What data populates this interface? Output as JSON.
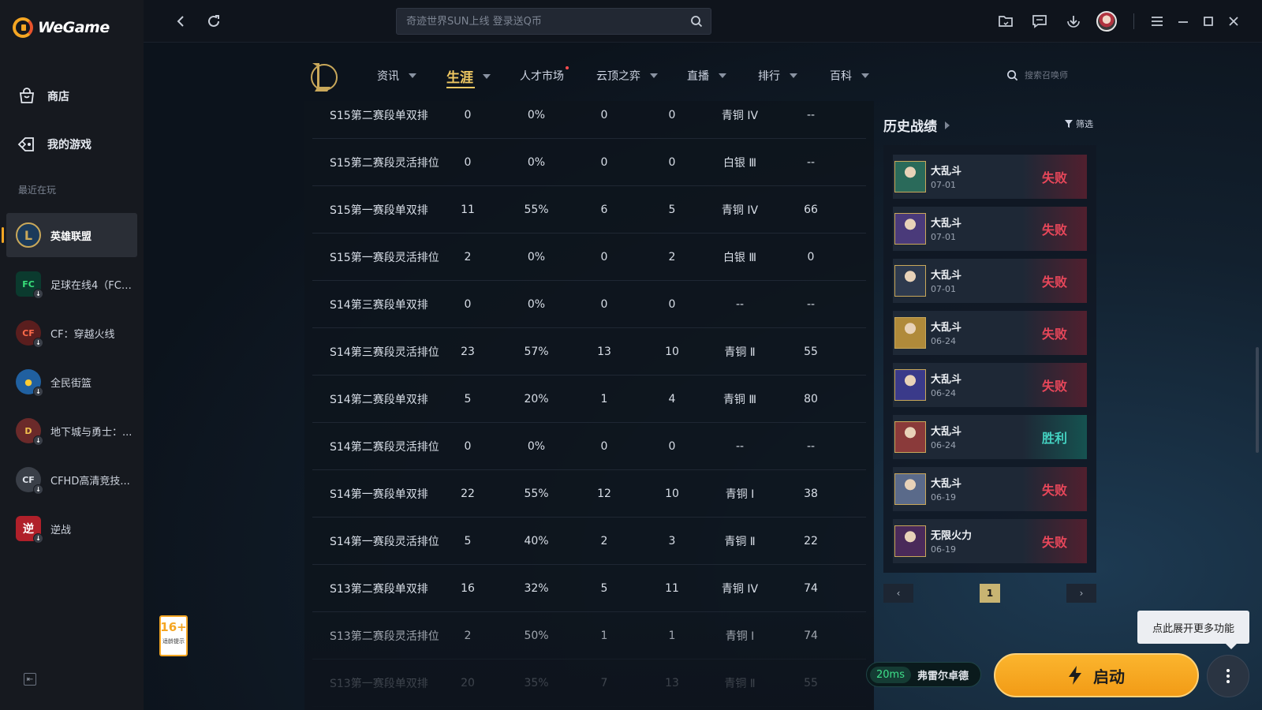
{
  "app": {
    "brand": "WeGame"
  },
  "sidebar": {
    "nav": [
      {
        "label": "商店",
        "icon": "shop-bag-icon"
      },
      {
        "label": "我的游戏",
        "icon": "game-tag-icon"
      }
    ],
    "recent_label": "最近在玩",
    "games": [
      {
        "name": "英雄联盟",
        "active": true,
        "icon": "lol-icon",
        "color": "#1b3a5a"
      },
      {
        "name": "足球在线4（FC ...",
        "active": false,
        "icon": "fc-online-icon",
        "color": "#0b3a2e"
      },
      {
        "name": "CF：穿越火线",
        "active": false,
        "icon": "crossfire-icon",
        "color": "#5a1e1e"
      },
      {
        "name": "全民街篮",
        "active": false,
        "icon": "street-basketball-icon",
        "color": "#2060a0"
      },
      {
        "name": "地下城与勇士：...",
        "active": false,
        "icon": "dnf-icon",
        "color": "#6b2a2a"
      },
      {
        "name": "CFHD高清竞技...",
        "active": false,
        "icon": "cfhd-icon",
        "color": "#3a3f48"
      },
      {
        "name": "逆战",
        "active": false,
        "icon": "nizhan-icon",
        "color": "#b0202a"
      }
    ]
  },
  "topbar": {
    "search_placeholder": "奇迹世界SUN上线 登录送Q币"
  },
  "lol_nav": {
    "items": [
      {
        "label": "资讯",
        "caret": true
      },
      {
        "label": "生涯",
        "caret": true,
        "active": true
      },
      {
        "label": "人才市场",
        "caret": false,
        "dot": true
      },
      {
        "label": "云顶之弈",
        "caret": true
      },
      {
        "label": "直播",
        "caret": true
      },
      {
        "label": "排行",
        "caret": true
      },
      {
        "label": "百科",
        "caret": true
      }
    ],
    "summoner_search_placeholder": "搜索召唤师"
  },
  "season_table": {
    "rows": [
      [
        "S15第二赛段单双排",
        "0",
        "0%",
        "0",
        "0",
        "青铜 IV",
        "--"
      ],
      [
        "S15第二赛段灵活排位",
        "0",
        "0%",
        "0",
        "0",
        "白银 Ⅲ",
        "--"
      ],
      [
        "S15第一赛段单双排",
        "11",
        "55%",
        "6",
        "5",
        "青铜 IV",
        "66"
      ],
      [
        "S15第一赛段灵活排位",
        "2",
        "0%",
        "0",
        "2",
        "白银 Ⅲ",
        "0"
      ],
      [
        "S14第三赛段单双排",
        "0",
        "0%",
        "0",
        "0",
        "--",
        "--"
      ],
      [
        "S14第三赛段灵活排位",
        "23",
        "57%",
        "13",
        "10",
        "青铜 Ⅱ",
        "55"
      ],
      [
        "S14第二赛段单双排",
        "5",
        "20%",
        "1",
        "4",
        "青铜 Ⅲ",
        "80"
      ],
      [
        "S14第二赛段灵活排位",
        "0",
        "0%",
        "0",
        "0",
        "--",
        "--"
      ],
      [
        "S14第一赛段单双排",
        "22",
        "55%",
        "12",
        "10",
        "青铜 Ⅰ",
        "38"
      ],
      [
        "S14第一赛段灵活排位",
        "5",
        "40%",
        "2",
        "3",
        "青铜 Ⅱ",
        "22"
      ],
      [
        "S13第二赛段单双排",
        "16",
        "32%",
        "5",
        "11",
        "青铜 IV",
        "74"
      ],
      [
        "S13第二赛段灵活排位",
        "2",
        "50%",
        "1",
        "1",
        "青铜 Ⅰ",
        "74"
      ],
      [
        "S13第一赛段单双排",
        "20",
        "35%",
        "7",
        "13",
        "青铜 Ⅱ",
        "55"
      ]
    ]
  },
  "history": {
    "title": "历史战绩",
    "filter_label": "筛选",
    "matches": [
      {
        "mode": "大乱斗",
        "date": "07-01",
        "result": "失败",
        "win": false,
        "champ_color": "#2a6a5a"
      },
      {
        "mode": "大乱斗",
        "date": "07-01",
        "result": "失败",
        "win": false,
        "champ_color": "#4a3a7a"
      },
      {
        "mode": "大乱斗",
        "date": "07-01",
        "result": "失败",
        "win": false,
        "champ_color": "#2e3a4e"
      },
      {
        "mode": "大乱斗",
        "date": "06-24",
        "result": "失败",
        "win": false,
        "champ_color": "#b08a3a"
      },
      {
        "mode": "大乱斗",
        "date": "06-24",
        "result": "失败",
        "win": false,
        "champ_color": "#3a3a8a"
      },
      {
        "mode": "大乱斗",
        "date": "06-24",
        "result": "胜利",
        "win": true,
        "champ_color": "#8a3a3a"
      },
      {
        "mode": "大乱斗",
        "date": "06-19",
        "result": "失败",
        "win": false,
        "champ_color": "#5a6a8a"
      },
      {
        "mode": "无限火力",
        "date": "06-19",
        "result": "失败",
        "win": false,
        "champ_color": "#4a2a5a"
      }
    ],
    "page": "1"
  },
  "footer": {
    "age_rating": "16+",
    "age_note": "适龄提示",
    "ping": "20ms",
    "server": "弗雷尔卓德",
    "launch_label": "启动",
    "tooltip": "点此展开更多功能"
  },
  "colors": {
    "accent": "#f5a623",
    "lose": "#e8475a",
    "win": "#44d3c2",
    "gold": "#f0c862"
  }
}
